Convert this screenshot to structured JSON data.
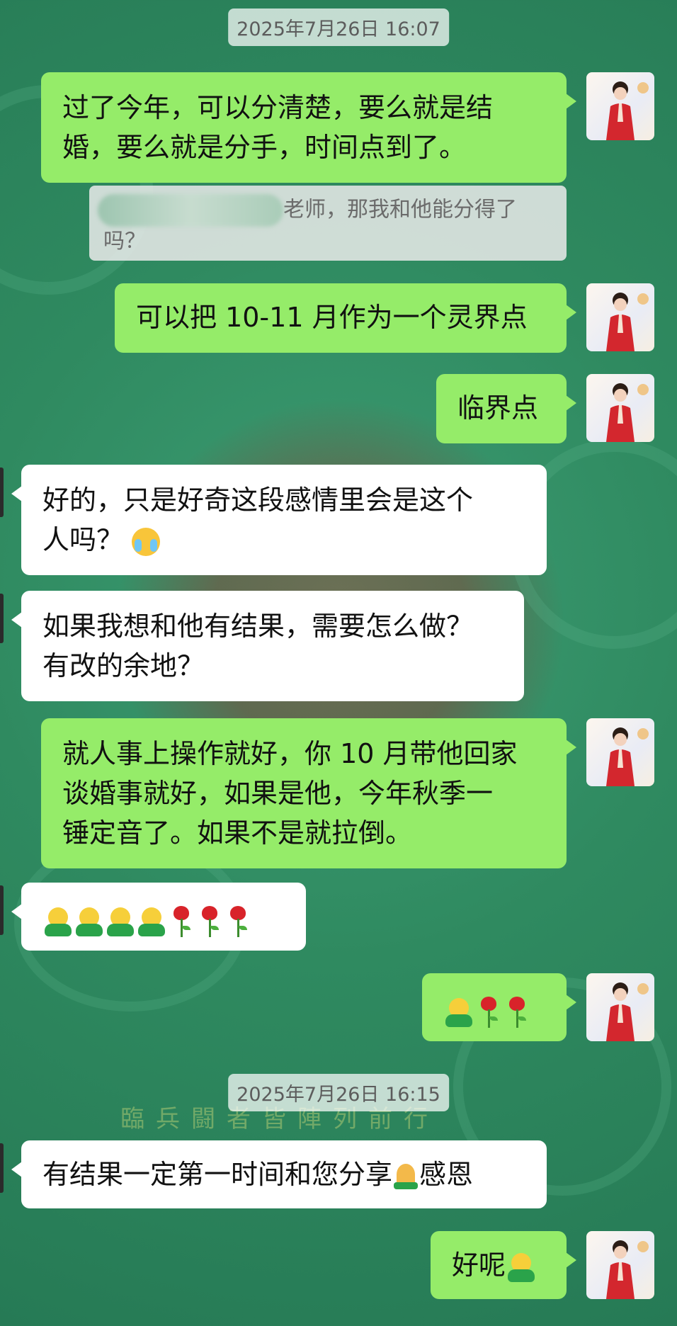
{
  "background": {
    "base_color": "#2f8a60",
    "decoration_text": "臨兵闘者皆陣列前行"
  },
  "colors": {
    "outgoing_bubble": "#95ec69",
    "incoming_bubble": "#ffffff",
    "timestamp_bg": "#e6ece8"
  },
  "timestamps": [
    "2025年7月26日 16:07",
    "2025年7月26日 16:15"
  ],
  "messages": [
    {
      "side": "out",
      "lines": [
        "过了今年，可以分清楚，要么就是结",
        "婚，要么就是分手，时间点到了。"
      ]
    },
    {
      "side": "quote",
      "text_suffix": "老师，那我和他能分得了",
      "text_line2": "吗？"
    },
    {
      "side": "out",
      "text": "可以把 10-11 月作为一个灵界点"
    },
    {
      "side": "out",
      "text": "临界点"
    },
    {
      "side": "in",
      "lines": [
        "好的，只是好奇这段感情里会是这个",
        "人吗？"
      ],
      "emoji": "face-with-tears-icon"
    },
    {
      "side": "in",
      "lines": [
        "如果我想和他有结果，需要怎么做？",
        "有改的余地？"
      ]
    },
    {
      "side": "out",
      "lines": [
        "就人事上操作就好，你 10 月带他回家",
        "谈婚事就好，如果是他，今年秋季一",
        "锤定音了。如果不是就拉倒。"
      ]
    },
    {
      "side": "in",
      "emoji_sequence": [
        "smiling-person-icon",
        "smiling-person-icon",
        "smiling-person-icon",
        "smiling-person-icon",
        "rose-icon",
        "rose-icon",
        "rose-icon"
      ]
    },
    {
      "side": "out",
      "emoji_sequence": [
        "smiling-person-icon",
        "rose-icon",
        "rose-icon"
      ]
    },
    {
      "side": "in",
      "text_before": "有结果一定第一时间和您分享",
      "emoji": "praying-hands-icon",
      "text_after": "感恩"
    },
    {
      "side": "out",
      "text": "好呢",
      "emoji": "smiling-person-icon"
    }
  ]
}
